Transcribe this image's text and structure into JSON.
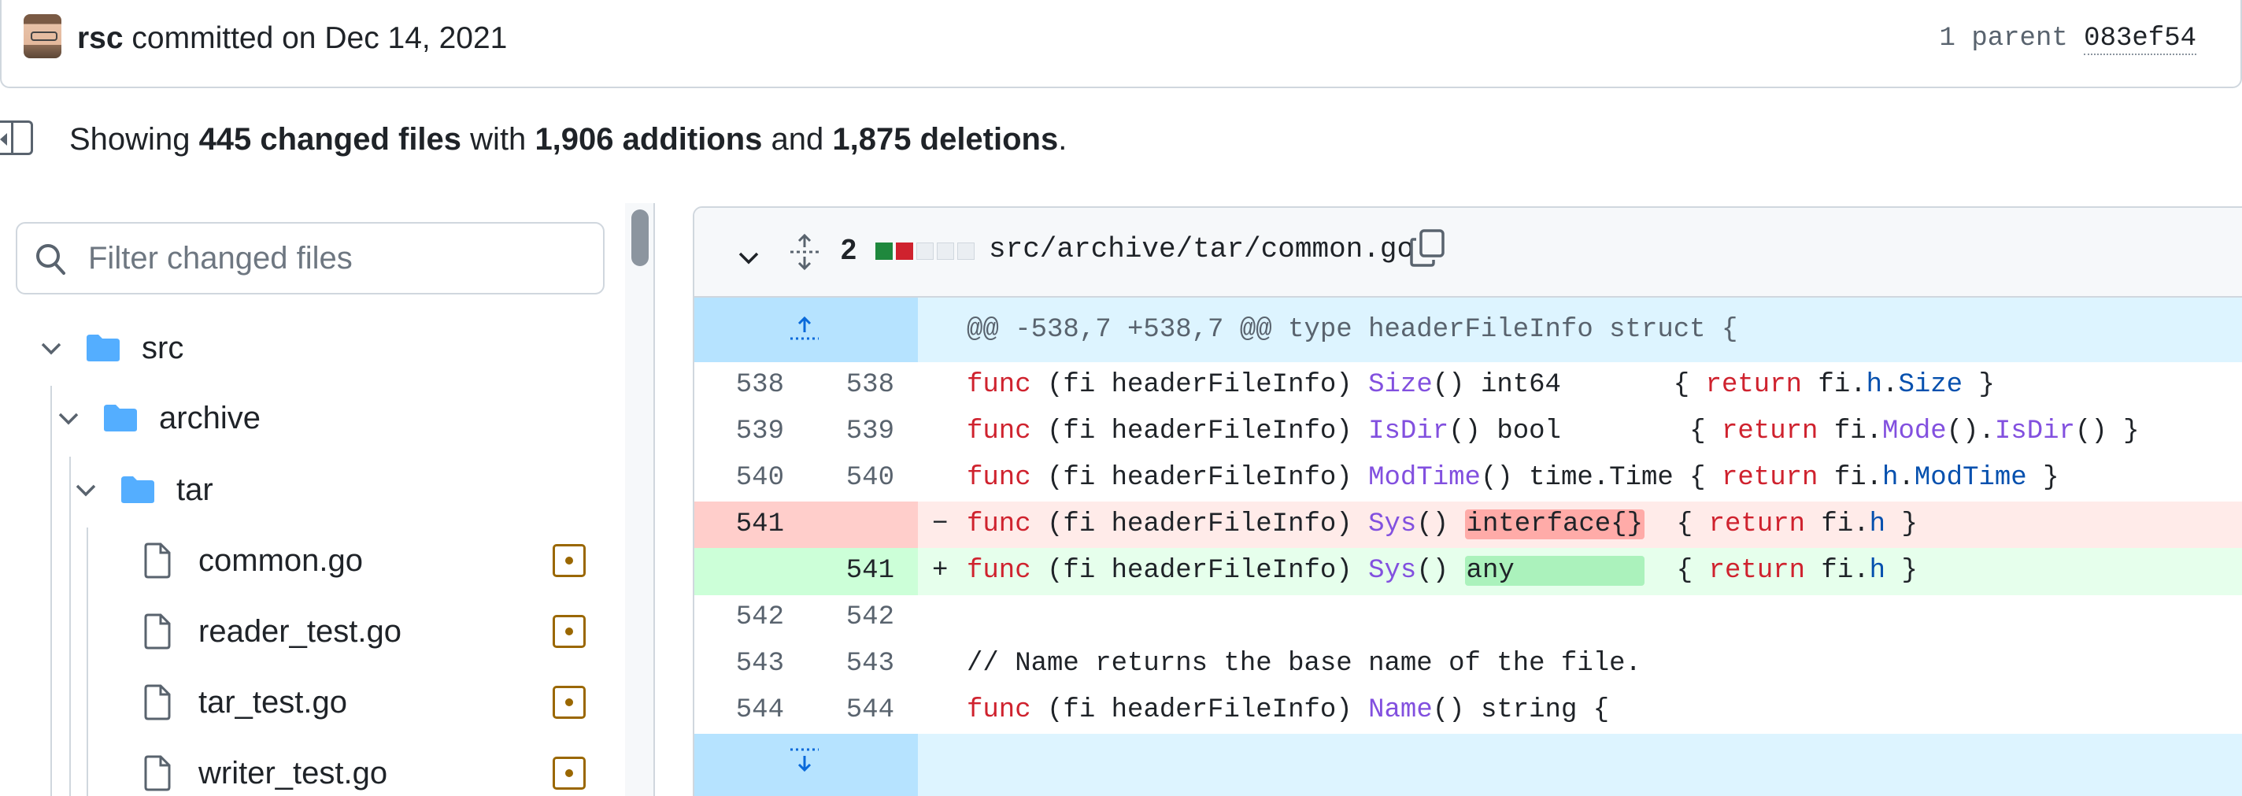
{
  "commit": {
    "author": "rsc",
    "committed_text": "committed on Dec 14, 2021",
    "parent_label": "1 parent",
    "parent_sha": "083ef54"
  },
  "summary": {
    "prefix": "Showing",
    "files_changed": "445 changed files",
    "with": "with",
    "additions": "1,906 additions",
    "and": "and",
    "deletions": "1,875 deletions",
    "suffix": "."
  },
  "file_tree": {
    "filter_placeholder": "Filter changed files",
    "folders": [
      {
        "label": "src"
      },
      {
        "label": "archive"
      },
      {
        "label": "tar"
      }
    ],
    "files": [
      {
        "label": "common.go"
      },
      {
        "label": "reader_test.go"
      },
      {
        "label": "tar_test.go"
      },
      {
        "label": "writer_test.go"
      }
    ]
  },
  "diff_file": {
    "changes_count": "2",
    "path": "src/archive/tar/common.go",
    "hunk_header": "@@ -538,7 +538,7 @@ type headerFileInfo struct {",
    "lines": [
      {
        "old": "538",
        "new": "538",
        "marker": ""
      },
      {
        "old": "539",
        "new": "539",
        "marker": ""
      },
      {
        "old": "540",
        "new": "540",
        "marker": ""
      },
      {
        "old": "541",
        "new": "",
        "marker": "−"
      },
      {
        "old": "",
        "new": "541",
        "marker": "+"
      },
      {
        "old": "542",
        "new": "542",
        "marker": ""
      },
      {
        "old": "543",
        "new": "543",
        "marker": ""
      },
      {
        "old": "544",
        "new": "544",
        "marker": ""
      }
    ],
    "code": {
      "l538": {
        "kw1": "func",
        "recv": " (fi headerFileInfo) ",
        "fn": "Size",
        "rest": "() int64       { ",
        "kw2": "return",
        "obj": " fi.",
        "p1": "h",
        "dot": ".",
        "p2": "Size",
        "end": " }"
      },
      "l539": {
        "kw1": "func",
        "recv": " (fi headerFileInfo) ",
        "fn": "IsDir",
        "rest": "() bool        { ",
        "kw2": "return",
        "obj": " fi.",
        "p1": "Mode",
        "mid": "().",
        "p2": "IsDir",
        "end": "() }"
      },
      "l540": {
        "kw1": "func",
        "recv": " (fi headerFileInfo) ",
        "fn": "ModTime",
        "rest": "() time.Time { ",
        "kw2": "return",
        "obj": " fi.",
        "p1": "h",
        "dot": ".",
        "p2": "ModTime",
        "end": " }"
      },
      "l541_del": {
        "kw1": "func",
        "recv": " (fi headerFileInfo) ",
        "fn": "Sys",
        "paren": "() ",
        "hl": "interface{}",
        "rest": "  { ",
        "kw2": "return",
        "obj": " fi.",
        "p1": "h",
        "end": " }"
      },
      "l541_add": {
        "kw1": "func",
        "recv": " (fi headerFileInfo) ",
        "fn": "Sys",
        "paren": "() ",
        "hl": "any        ",
        "rest": "  { ",
        "kw2": "return",
        "obj": " fi.",
        "p1": "h",
        "end": " }"
      },
      "l543": {
        "comment": "// Name returns the base name of the file."
      },
      "l544": {
        "kw1": "func",
        "recv": " (fi headerFileInfo) ",
        "fn": "Name",
        "rest": "() string {"
      }
    }
  },
  "colors": {
    "addition": "#1f883d",
    "deletion": "#cf222e",
    "modified_badge": "#9a6700",
    "hunk_bg": "#ddf4ff"
  },
  "icons": [
    "sidebar-toggle-icon",
    "search-icon",
    "chevron-down-icon",
    "folder-icon",
    "file-icon",
    "file-modified-icon",
    "expand-icon",
    "copy-icon",
    "expand-up-icon",
    "expand-down-icon"
  ]
}
